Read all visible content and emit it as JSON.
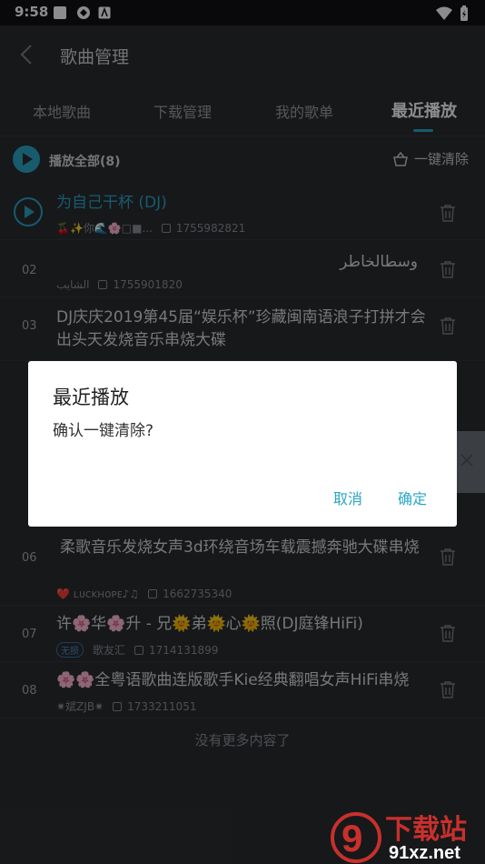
{
  "status": {
    "time": "9:58"
  },
  "header": {
    "title": "歌曲管理"
  },
  "tabs": [
    {
      "label": "本地歌曲"
    },
    {
      "label": "下载管理"
    },
    {
      "label": "我的歌单"
    },
    {
      "label": "最近播放"
    }
  ],
  "toolbar": {
    "play_all": "播放全部(8)",
    "clear_all": "一键清除"
  },
  "songs": [
    {
      "num": "",
      "title": "为自己干杯 (DJ)",
      "artist": "🍒✨你🌊🌸□■...",
      "date": "1755982821"
    },
    {
      "num": "02",
      "title": "وسطالخاطر",
      "artist": "الشايب",
      "date": "1755901820"
    },
    {
      "num": "03",
      "title": "DJ庆庆2019第45届“娱乐杯”珍藏闽南语浪子打拼才会出头天发烧音乐串烧大碟",
      "artist": "",
      "date": ""
    },
    {
      "num": "06",
      "title": "柔歌音乐发烧女声3d环绕音场车载震撼奔驰大碟串烧",
      "artist": "❤️ ʟᴜᴄᴋʜᴏᴘᴇ♪♫",
      "date": "1662735340"
    },
    {
      "num": "07",
      "title": "许🌸华🌸升 - 兄🌞弟🌞心🌞照(DJ庭锋HiFi)",
      "badge": "无损",
      "artist": "歌友汇",
      "date": "1714131899"
    },
    {
      "num": "08",
      "title": "🌸🌸全粤语歌曲连版歌手Kie经典翻唱女声HiFi串烧",
      "artist": "✷斌ZJB✷",
      "date": "1733211051"
    }
  ],
  "footer": {
    "no_more": "没有更多内容了"
  },
  "dialog": {
    "title": "最近播放",
    "message": "确认一键清除?",
    "cancel": "取消",
    "confirm": "确定"
  },
  "watermark": {
    "text1": "下载站",
    "text2": "91xz.net"
  },
  "colors": {
    "accent": "#2aa6c7",
    "background": "#2a2d31"
  }
}
